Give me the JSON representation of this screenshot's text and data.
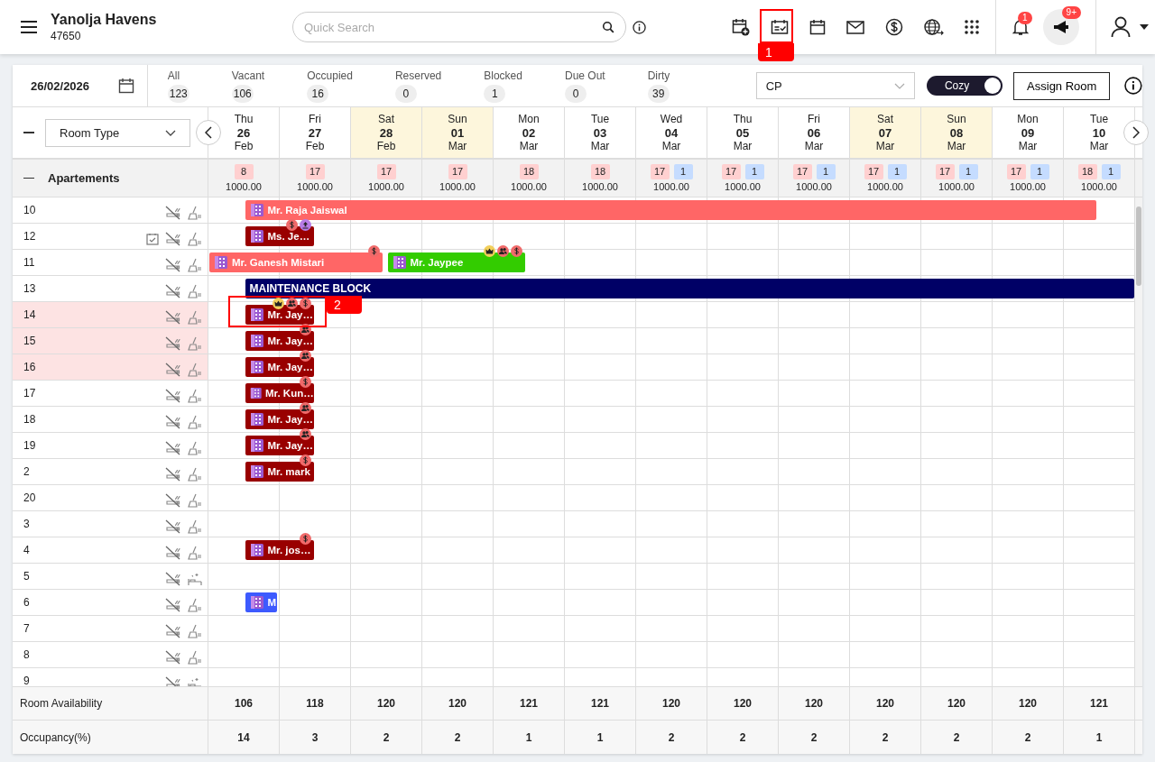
{
  "app": {
    "title": "Yanolja Havens",
    "code": "47650"
  },
  "search": {
    "placeholder": "Quick Search"
  },
  "notifications": {
    "badge": "1"
  },
  "announcements": {
    "badge": "9+"
  },
  "date": "26/02/2026",
  "stats": [
    {
      "label": "All",
      "count": "123"
    },
    {
      "label": "Vacant",
      "count": "106"
    },
    {
      "label": "Occupied",
      "count": "16"
    },
    {
      "label": "Reserved",
      "count": "0"
    },
    {
      "label": "Blocked",
      "count": "1"
    },
    {
      "label": "Due Out",
      "count": "0"
    },
    {
      "label": "Dirty",
      "count": "39"
    }
  ],
  "rate_plan": {
    "value": "CP"
  },
  "view_toggle": {
    "label": "Cozy",
    "on": true
  },
  "assign_button": "Assign Room",
  "room_type_filter": {
    "value": "Room Type"
  },
  "days": [
    {
      "weekday": "Thu",
      "day": "26",
      "month": "Feb",
      "weekend": false
    },
    {
      "weekday": "Fri",
      "day": "27",
      "month": "Feb",
      "weekend": false
    },
    {
      "weekday": "Sat",
      "day": "28",
      "month": "Feb",
      "weekend": true
    },
    {
      "weekday": "Sun",
      "day": "01",
      "month": "Mar",
      "weekend": true
    },
    {
      "weekday": "Mon",
      "day": "02",
      "month": "Mar",
      "weekend": false
    },
    {
      "weekday": "Tue",
      "day": "03",
      "month": "Mar",
      "weekend": false
    },
    {
      "weekday": "Wed",
      "day": "04",
      "month": "Mar",
      "weekend": false
    },
    {
      "weekday": "Thu",
      "day": "05",
      "month": "Mar",
      "weekend": false
    },
    {
      "weekday": "Fri",
      "day": "06",
      "month": "Mar",
      "weekend": false
    },
    {
      "weekday": "Sat",
      "day": "07",
      "month": "Mar",
      "weekend": true
    },
    {
      "weekday": "Sun",
      "day": "08",
      "month": "Mar",
      "weekend": true
    },
    {
      "weekday": "Mon",
      "day": "09",
      "month": "Mar",
      "weekend": false
    },
    {
      "weekday": "Tue",
      "day": "10",
      "month": "Mar",
      "weekend": false
    }
  ],
  "group": {
    "name": "Apartements",
    "expanded": true,
    "days": [
      {
        "booked": "8",
        "price": "1000.00"
      },
      {
        "booked": "17",
        "price": "1000.00"
      },
      {
        "booked": "17",
        "price": "1000.00"
      },
      {
        "booked": "17",
        "price": "1000.00"
      },
      {
        "booked": "18",
        "price": "1000.00"
      },
      {
        "booked": "18",
        "price": "1000.00"
      },
      {
        "booked": "17",
        "blocked": "1",
        "price": "1000.00"
      },
      {
        "booked": "17",
        "blocked": "1",
        "price": "1000.00"
      },
      {
        "booked": "17",
        "blocked": "1",
        "price": "1000.00"
      },
      {
        "booked": "17",
        "blocked": "1",
        "price": "1000.00"
      },
      {
        "booked": "17",
        "blocked": "1",
        "price": "1000.00"
      },
      {
        "booked": "17",
        "blocked": "1",
        "price": "1000.00"
      },
      {
        "booked": "18",
        "blocked": "1",
        "price": "1000.00"
      }
    ]
  },
  "rooms": [
    {
      "room": "10",
      "highlighted": false,
      "dirty": true,
      "task": false,
      "bookings": [
        {
          "guest": "Mr. Raja Jaiswal",
          "kind": "reservation",
          "color": "#ff6666",
          "vip": false,
          "group": false,
          "payment": false,
          "upload": false
        }
      ]
    },
    {
      "room": "12",
      "highlighted": false,
      "dirty": true,
      "task": true,
      "bookings": [
        {
          "guest": "Ms. Je…",
          "kind": "reservation",
          "color": "#990000",
          "vip": false,
          "group": false,
          "payment": true,
          "upload": true
        }
      ]
    },
    {
      "room": "11",
      "highlighted": false,
      "dirty": true,
      "task": false,
      "bookings": [
        {
          "guest": "Mr. Ganesh Mistari",
          "kind": "reservation",
          "color": "#ff6666",
          "vip": false,
          "group": false,
          "payment": true,
          "upload": false
        },
        {
          "guest": "Mr. Jaypee",
          "kind": "reservation",
          "color": "#33cc00",
          "vip": true,
          "group": true,
          "payment": true,
          "upload": false
        }
      ]
    },
    {
      "room": "13",
      "highlighted": false,
      "dirty": true,
      "task": false,
      "bookings": [
        {
          "guest": "MAINTENANCE BLOCK",
          "kind": "block",
          "color": "#000066",
          "vip": false,
          "group": false,
          "payment": false,
          "upload": false
        }
      ]
    },
    {
      "room": "14",
      "dirty": true,
      "task": false,
      "highlighted": true,
      "bookings": [
        {
          "guest": "Mr. Jay…",
          "kind": "reservation",
          "color": "#990000",
          "vip": true,
          "group": true,
          "payment": true,
          "upload": false
        }
      ]
    },
    {
      "room": "15",
      "dirty": true,
      "task": false,
      "highlighted": true,
      "bookings": [
        {
          "guest": "Mr. Jay…",
          "kind": "reservation",
          "color": "#990000",
          "vip": false,
          "group": true,
          "payment": false,
          "upload": false
        }
      ]
    },
    {
      "room": "16",
      "dirty": true,
      "task": false,
      "highlighted": true,
      "bookings": [
        {
          "guest": "Mr. Jay…",
          "kind": "reservation",
          "color": "#990000",
          "vip": false,
          "group": true,
          "payment": false,
          "upload": false
        }
      ]
    },
    {
      "room": "17",
      "highlighted": false,
      "dirty": true,
      "task": false,
      "bookings": [
        {
          "guest": "Mr. Kun…",
          "kind": "reservation",
          "color": "#990000",
          "vip": false,
          "group": false,
          "payment": true,
          "upload": false
        }
      ]
    },
    {
      "room": "18",
      "highlighted": false,
      "dirty": true,
      "task": false,
      "bookings": [
        {
          "guest": "Mr. Jay…",
          "kind": "reservation",
          "color": "#990000",
          "vip": false,
          "group": true,
          "payment": false,
          "upload": false
        }
      ]
    },
    {
      "room": "19",
      "highlighted": false,
      "dirty": true,
      "task": false,
      "bookings": [
        {
          "guest": "Mr. Jay…",
          "kind": "reservation",
          "color": "#990000",
          "vip": false,
          "group": true,
          "payment": false,
          "upload": false
        }
      ]
    },
    {
      "room": "2",
      "highlighted": false,
      "dirty": true,
      "task": false,
      "bookings": [
        {
          "guest": "Mr. mark",
          "kind": "reservation",
          "color": "#990000",
          "vip": false,
          "group": false,
          "payment": true,
          "upload": false
        }
      ]
    },
    {
      "room": "20",
      "highlighted": false,
      "dirty": true,
      "task": false
    },
    {
      "room": "3",
      "highlighted": false,
      "dirty": true,
      "task": false
    },
    {
      "room": "4",
      "highlighted": false,
      "dirty": true,
      "task": false,
      "bookings": [
        {
          "guest": "Mr. jos…",
          "kind": "reservation",
          "color": "#990000",
          "vip": false,
          "group": false,
          "payment": true,
          "upload": false
        }
      ]
    },
    {
      "room": "5",
      "highlighted": false,
      "dirty": false,
      "task": false
    },
    {
      "room": "6",
      "highlighted": false,
      "dirty": true,
      "task": false,
      "bookings": [
        {
          "guest": "M",
          "kind": "reservation",
          "color": "#3d5afe",
          "vip": false,
          "group": false,
          "payment": false,
          "upload": false
        }
      ]
    },
    {
      "room": "7",
      "highlighted": false,
      "dirty": true,
      "task": false
    },
    {
      "room": "8",
      "highlighted": false,
      "dirty": true,
      "task": false
    },
    {
      "room": "9",
      "highlighted": false,
      "dirty": false,
      "task": false
    }
  ],
  "footer": [
    {
      "label": "Room Availability",
      "values": [
        "106",
        "118",
        "120",
        "120",
        "121",
        "121",
        "120",
        "120",
        "120",
        "120",
        "120",
        "120",
        "121"
      ]
    },
    {
      "label": "Occupancy(%)",
      "values": [
        "14",
        "3",
        "2",
        "2",
        "1",
        "1",
        "2",
        "2",
        "2",
        "2",
        "2",
        "2",
        "1"
      ]
    }
  ],
  "markers": [
    {
      "label": "1"
    },
    {
      "label": "2"
    }
  ]
}
